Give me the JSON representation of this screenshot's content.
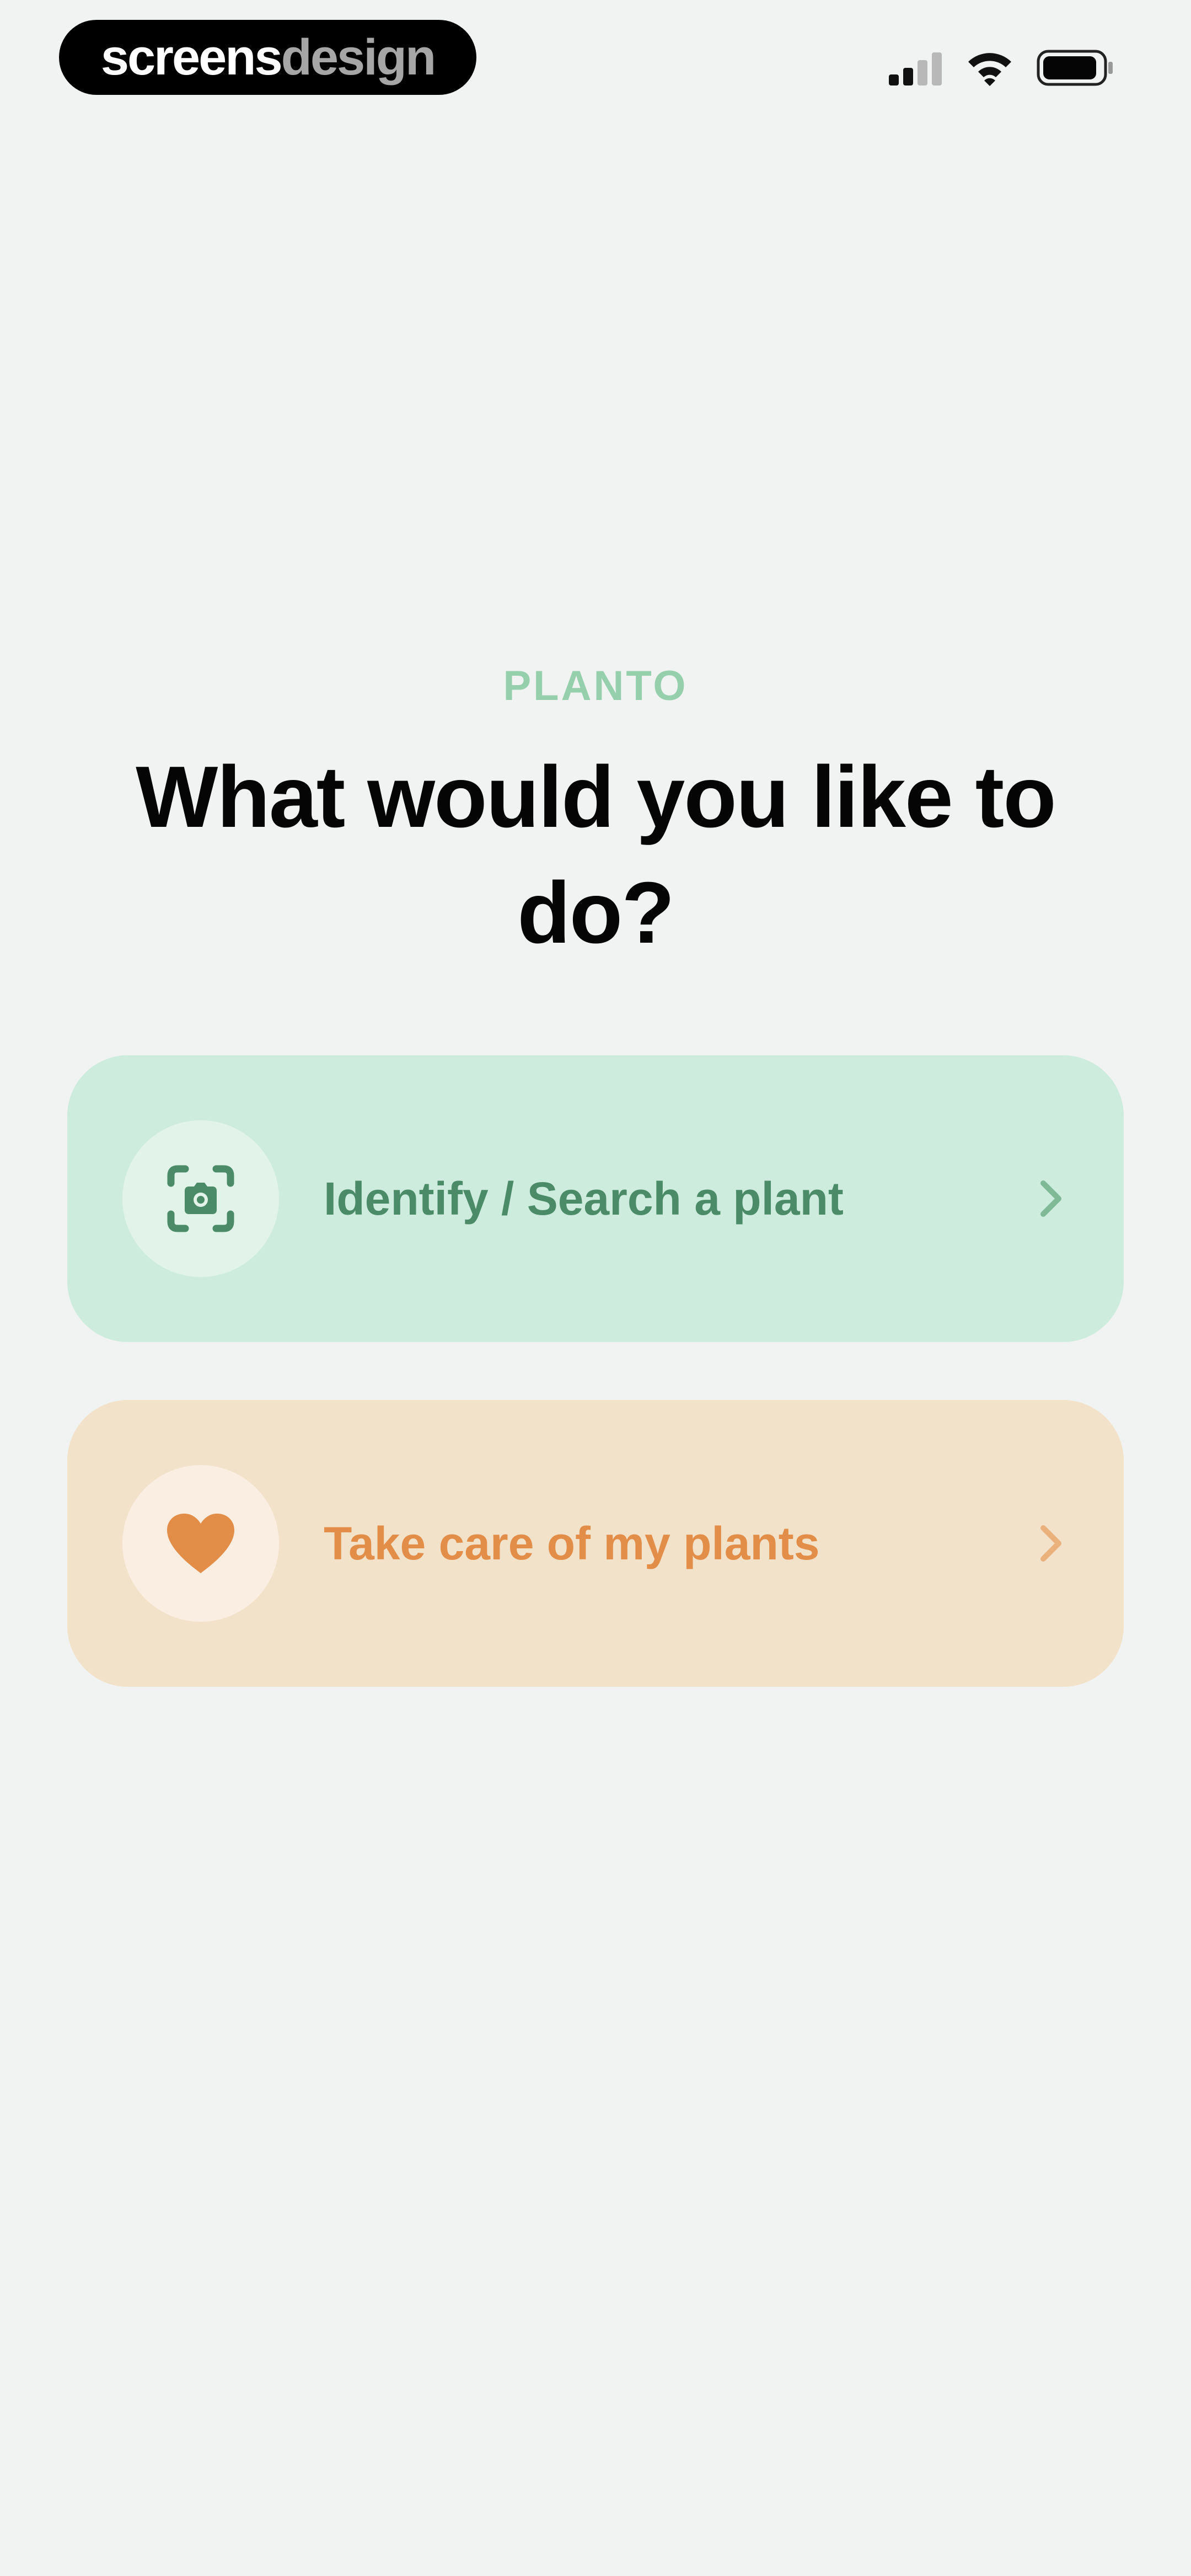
{
  "status_bar": {
    "brand_left": "screens",
    "brand_right": "design",
    "icons": [
      "signal-icon",
      "wifi-icon",
      "battery-icon"
    ]
  },
  "app": {
    "name": "PLANTO",
    "headline": "What would you like to do?"
  },
  "options": [
    {
      "label": "Identify / Search a plant",
      "icon": "camera-scan-icon",
      "accent": "#4b8b67",
      "background": "#cdecdd"
    },
    {
      "label": "Take care of my plants",
      "icon": "heart-icon",
      "accent": "#e28d48",
      "background": "#f2e2ca"
    }
  ]
}
